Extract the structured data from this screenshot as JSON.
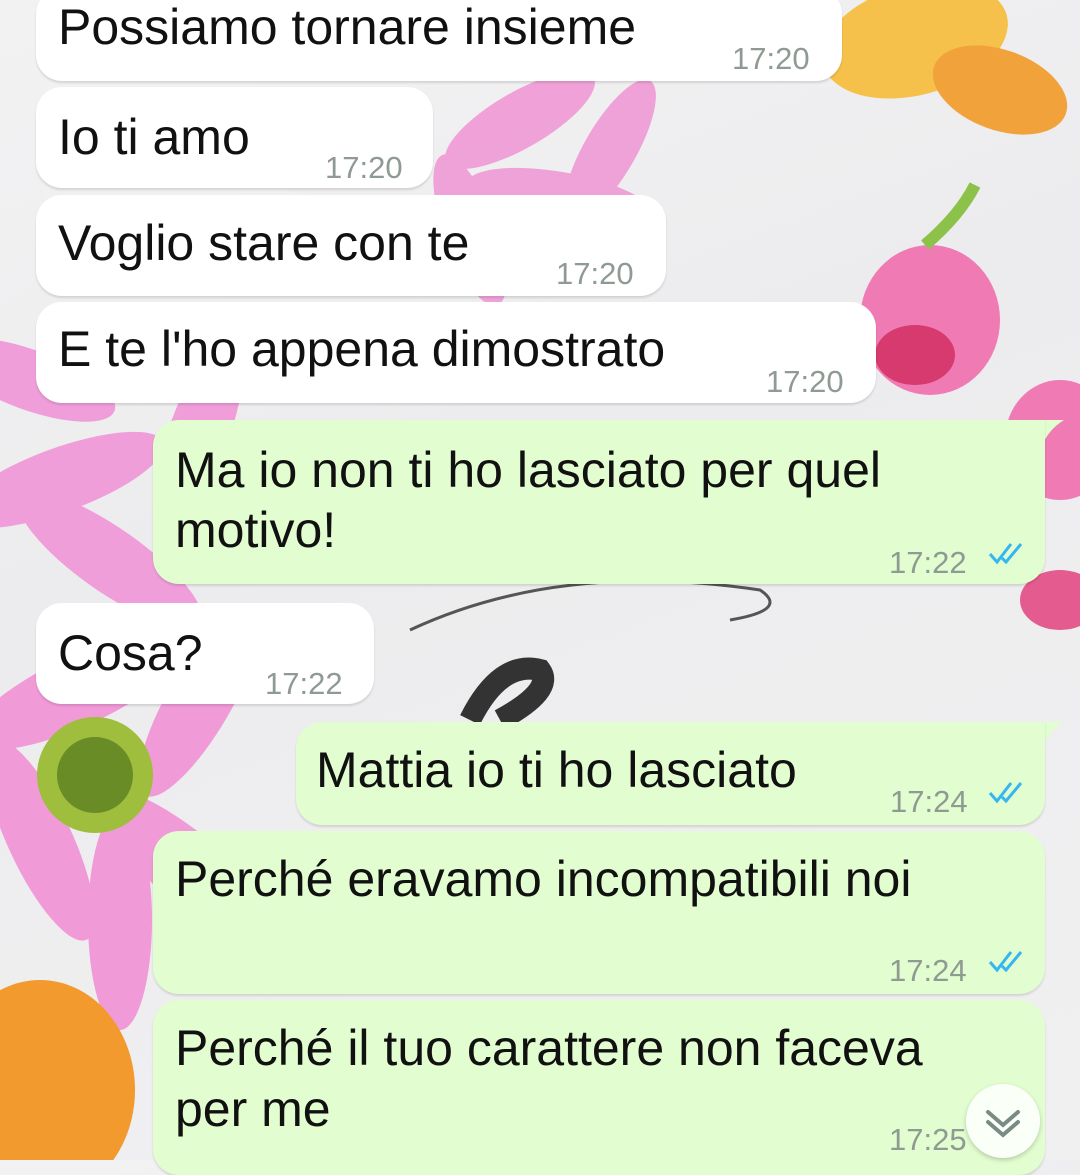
{
  "messages": [
    {
      "direction": "in",
      "text": "Possiamo tornare insieme",
      "time": "17:20"
    },
    {
      "direction": "in",
      "text": "Io ti amo",
      "time": "17:20"
    },
    {
      "direction": "in",
      "text": "Voglio stare con te",
      "time": "17:20"
    },
    {
      "direction": "in",
      "text": "E te l'ho appena dimostrato",
      "time": "17:20"
    },
    {
      "direction": "out",
      "text_line1": "Ma io non ti ho lasciato per quel",
      "text_line2": "motivo!",
      "time": "17:22",
      "status": "read"
    },
    {
      "direction": "in",
      "text": "Cosa?",
      "time": "17:22"
    },
    {
      "direction": "out",
      "text": "Mattia io ti ho lasciato",
      "time": "17:24",
      "status": "read"
    },
    {
      "direction": "out",
      "text": "Perché eravamo incompatibili noi",
      "time": "17:24",
      "status": "read"
    },
    {
      "direction": "out",
      "text_line1": "Perché il tuo carattere non faceva",
      "text_line2": "per me",
      "time": "17:25",
      "status": "read"
    }
  ],
  "colors": {
    "incoming_bubble": "#ffffff",
    "outgoing_bubble": "#e2fdd0",
    "timestamp": "#8f9a93",
    "read_ticks": "#34b7f1"
  },
  "icons": {
    "read_receipt": "double-check-icon",
    "scroll_down": "chevron-down-icon"
  }
}
